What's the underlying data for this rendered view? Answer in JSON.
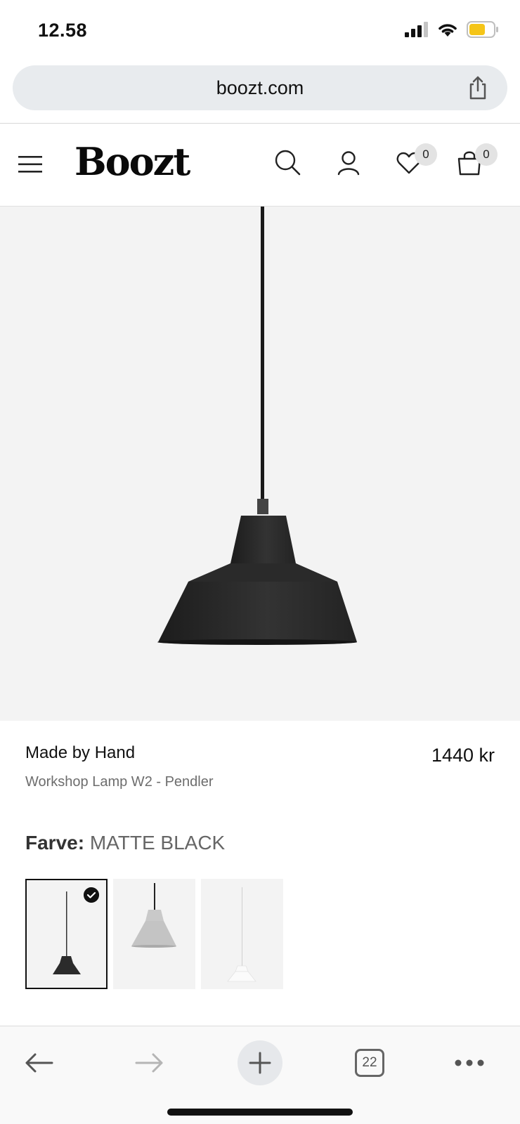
{
  "status_bar": {
    "time": "12.58",
    "battery_color": "#f5c518"
  },
  "browser": {
    "url": "boozt.com",
    "tabs_count": "22"
  },
  "header": {
    "logo": "Boozt",
    "wishlist_count": "0",
    "cart_count": "0"
  },
  "product": {
    "brand": "Made by Hand",
    "name": "Workshop Lamp W2 - Pendler",
    "price": "1440 kr",
    "color_label": "Farve:",
    "color_value": "MATTE BLACK",
    "swatches": [
      {
        "color": "#2b2b2b",
        "selected": true
      },
      {
        "color": "#c9c9c9",
        "selected": false
      },
      {
        "color": "#f7f7f7",
        "selected": false
      }
    ]
  },
  "icons": {
    "menu": "menu-icon",
    "search": "search-icon",
    "account": "user-icon",
    "wishlist": "heart-icon",
    "cart": "bag-icon",
    "share": "share-icon",
    "back": "arrow-left-icon",
    "forward": "arrow-right-icon",
    "new_tab": "plus-icon",
    "more": "more-icon"
  }
}
